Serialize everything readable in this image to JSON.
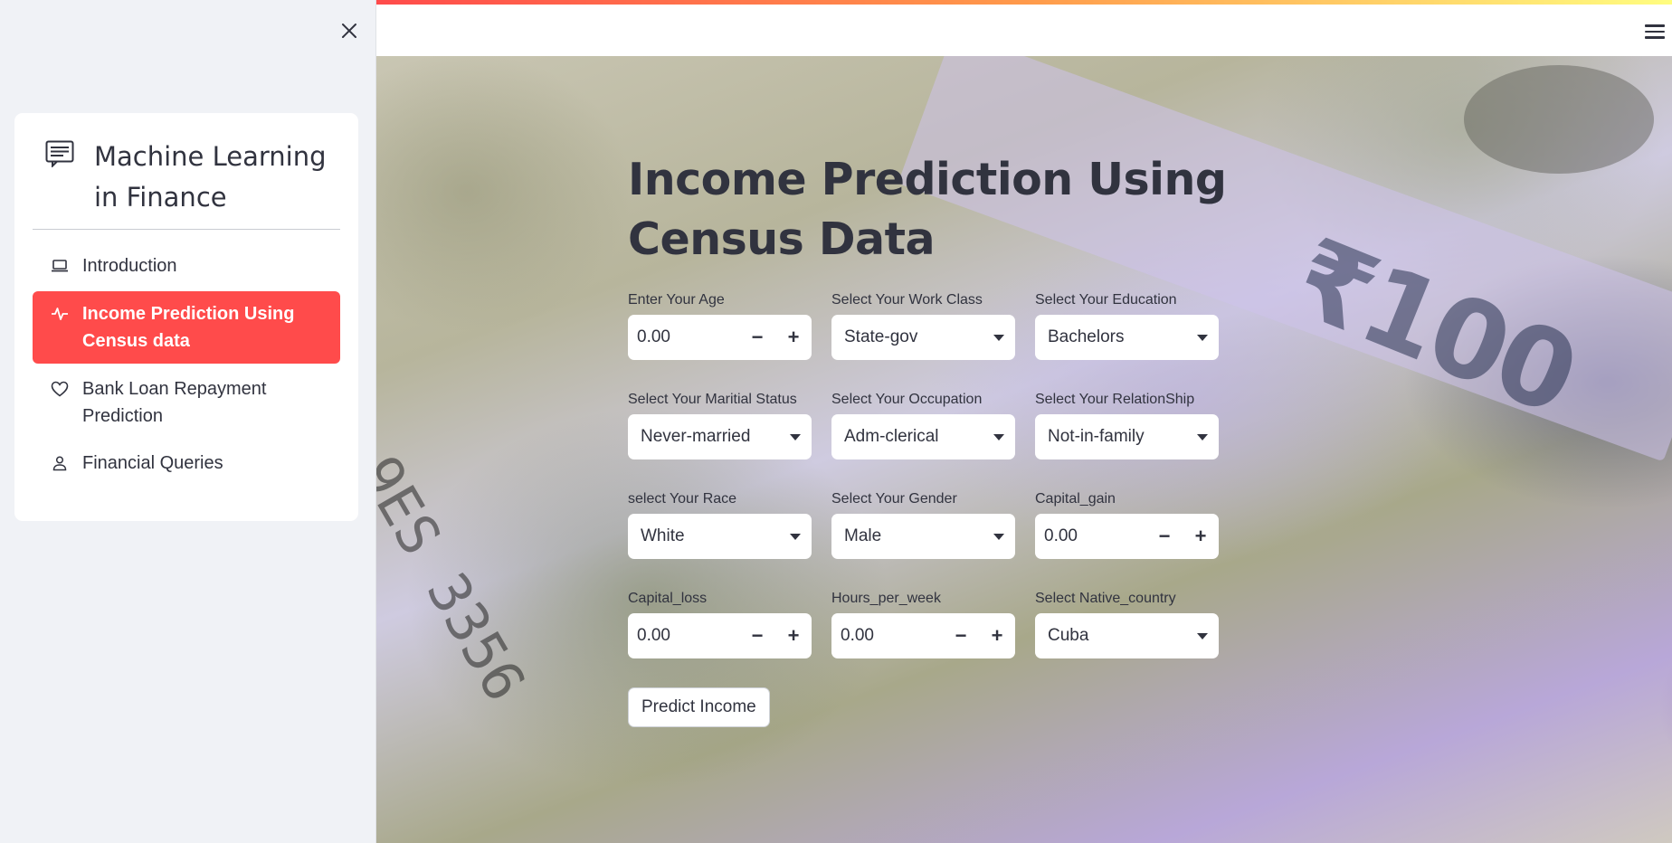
{
  "sidebar": {
    "close_icon": "close-icon",
    "menu": {
      "title": "Machine Learning in Finance",
      "title_line1": "Machine Learning",
      "title_line2": "in Finance",
      "title_icon": "card-text-icon",
      "items": [
        {
          "label": "Introduction",
          "icon": "laptop-icon",
          "active": false
        },
        {
          "label": "Income Prediction Using Census data",
          "icon": "activity-icon",
          "active": true
        },
        {
          "label": "Bank Loan Repayment Prediction",
          "icon": "heart-icon",
          "active": false
        },
        {
          "label": "Financial Queries",
          "icon": "person-icon",
          "active": false
        }
      ],
      "active_color": "#ff4b4b"
    }
  },
  "header": {
    "menu_icon": "hamburger-icon"
  },
  "main": {
    "title": "Income Prediction Using Census Data",
    "fields": [
      {
        "label": "Enter Your Age",
        "type": "number",
        "value": "0.00"
      },
      {
        "label": "Select Your Work Class",
        "type": "select",
        "value": "State-gov"
      },
      {
        "label": "Select Your Education",
        "type": "select",
        "value": "Bachelors"
      },
      {
        "label": "Select Your Maritial Status",
        "type": "select",
        "value": "Never-married"
      },
      {
        "label": "Select Your Occupation",
        "type": "select",
        "value": "Adm-clerical"
      },
      {
        "label": "Select Your RelationShip",
        "type": "select",
        "value": "Not-in-family"
      },
      {
        "label": "select Your Race",
        "type": "select",
        "value": "White"
      },
      {
        "label": "Select Your Gender",
        "type": "select",
        "value": "Male"
      },
      {
        "label": "Capital_gain",
        "type": "number",
        "value": "0.00"
      },
      {
        "label": "Capital_loss",
        "type": "number",
        "value": "0.00"
      },
      {
        "label": "Hours_per_week",
        "type": "number",
        "value": "0.00"
      },
      {
        "label": "Select Native_country",
        "type": "select",
        "value": "Cuba"
      }
    ],
    "stepper": {
      "minus": "−",
      "plus": "+"
    },
    "predict_button": "Predict Income",
    "background_digits": "₹100",
    "background_serial": "9ES 3356"
  },
  "colors": {
    "accent": "#ff4b4b",
    "text": "#31333f",
    "sidebar_bg": "#f0f2f6"
  }
}
